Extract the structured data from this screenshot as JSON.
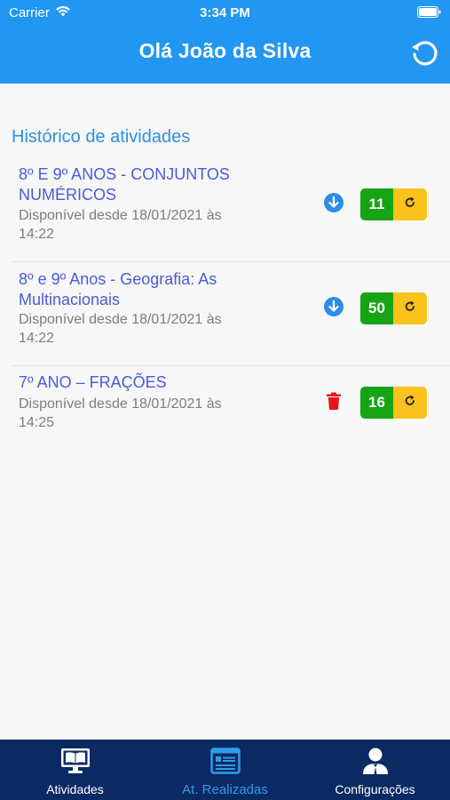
{
  "status_bar": {
    "carrier": "Carrier",
    "time": "3:34 PM"
  },
  "header": {
    "title": "Olá João da Silva",
    "refresh_icon": "refresh-icon"
  },
  "section": {
    "title": "Histórico de atividades"
  },
  "activities": [
    {
      "title": "8º E 9º ANOS - CONJUNTOS NUMÉRICOS",
      "subtitle": "Disponível desde 18/01/2021 às 14:22",
      "action_icon": "download-icon",
      "score": "11"
    },
    {
      "title": "8º e 9º Anos - Geografia: As Multinacionais",
      "subtitle": "Disponível desde 18/01/2021 às 14:22",
      "action_icon": "download-icon",
      "score": "50"
    },
    {
      "title": "7º ANO – FRAÇÕES",
      "subtitle": "Disponível desde 18/01/2021 às 14:25",
      "action_icon": "trash-icon",
      "score": "16"
    }
  ],
  "bottom_nav": {
    "items": [
      {
        "label": "Atividades",
        "icon": "monitor-book-icon",
        "active": false
      },
      {
        "label": "At. Realizadas",
        "icon": "list-screen-icon",
        "active": true
      },
      {
        "label": "Configurações",
        "icon": "user-icon",
        "active": false
      }
    ]
  },
  "colors": {
    "header": "#2196f3",
    "nav_bg": "#0b2a63",
    "active_nav": "#2f9bea",
    "title_text": "#4a5cd6",
    "score_green": "#16a316",
    "retry_yellow": "#f9c21c",
    "download_blue": "#2b8ee6",
    "trash_red": "#e8131b"
  }
}
